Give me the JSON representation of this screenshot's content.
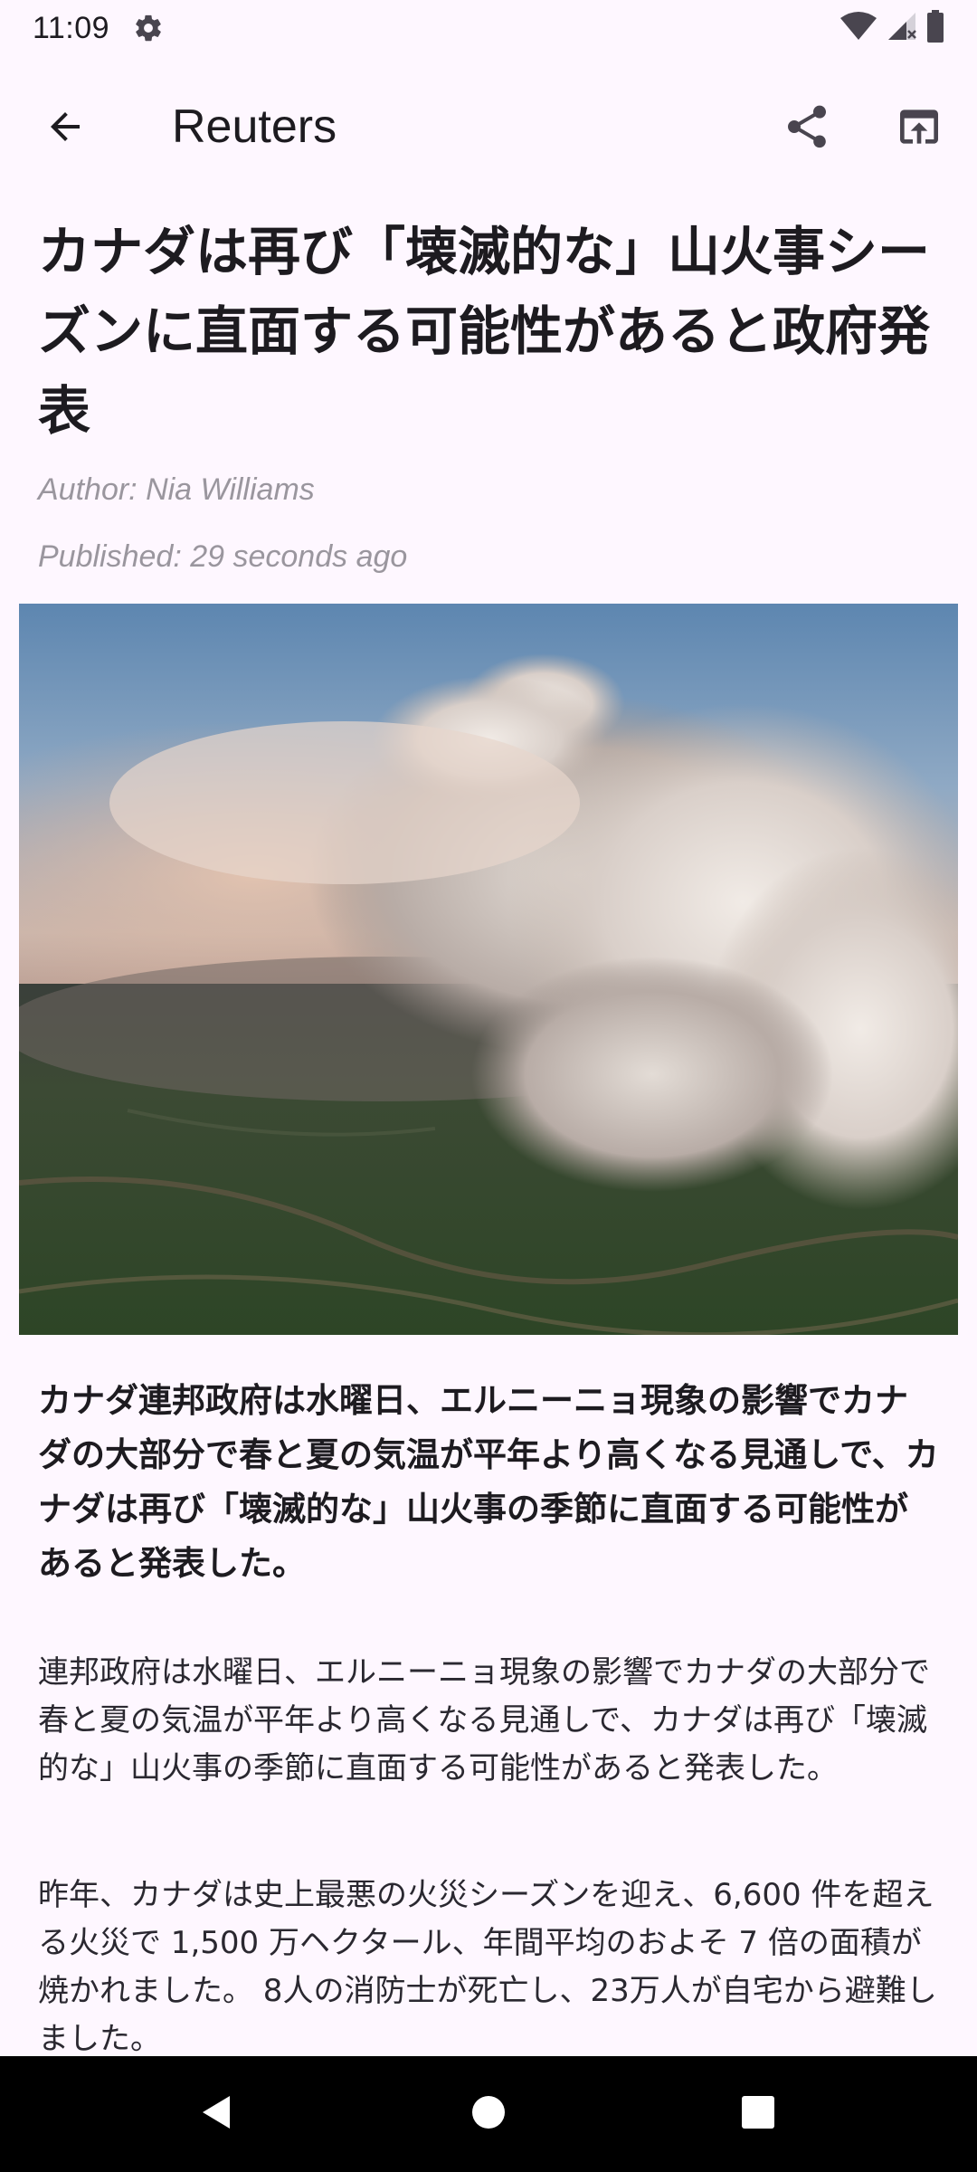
{
  "status_bar": {
    "time": "11:09",
    "icons": [
      "gear-icon",
      "wifi-icon",
      "cellular-signal-icon",
      "battery-icon"
    ]
  },
  "app_bar": {
    "title": "Reuters",
    "back_icon": "arrow-back-icon",
    "share_icon": "share-icon",
    "open_icon": "open-in-browser-icon"
  },
  "article": {
    "headline": "カナダは再び「壊滅的な」山火事シーズンに直面する可能性があると政府発表",
    "author": "Author: Nia Williams",
    "published": "Published: 29 seconds ago",
    "lead": "カナダ連邦政府は水曜日、エルニーニョ現象の影響でカナダの大部分で春と夏の気温が平年より高くなる見通しで、カナダは再び「壊滅的な」山火事の季節に直面する可能性があると発表した。",
    "paragraphs": [
      "連邦政府は水曜日、エルニーニョ現象の影響でカナダの大部分で春と夏の気温が平年より高くなる見通しで、カナダは再び「壊滅的な」山火事の季節に直面する可能性があると発表した。",
      "昨年、カナダは史上最悪の火災シーズンを迎え、6,600 件を超える火災で 1,500 万ヘクタール、年間平均のおよそ 7 倍の面積が焼かれました。 8人の消防士が死亡し、23万人が自宅から避難しました。"
    ]
  },
  "nav_bar": {
    "icons": [
      "nav-back-icon",
      "nav-home-icon",
      "nav-recents-icon"
    ]
  },
  "colors": {
    "background": "#fef7ff",
    "text": "#1d1b20",
    "meta_text": "#9a969e",
    "nav_bar": "#000000"
  }
}
